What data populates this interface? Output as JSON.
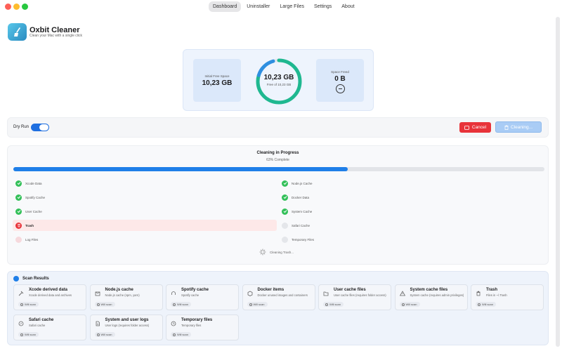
{
  "nav": {
    "tabs": [
      {
        "label": "Dashboard",
        "active": true
      },
      {
        "label": "Uninstaller",
        "active": false
      },
      {
        "label": "Large Files",
        "active": false
      },
      {
        "label": "Settings",
        "active": false
      },
      {
        "label": "About",
        "active": false
      }
    ]
  },
  "app": {
    "title": "Oxbit Cleaner",
    "subtitle": "Clean your Mac with a single click"
  },
  "space": {
    "initial_label": "Initial Free Space",
    "initial_value": "10,23 GB",
    "ring_value": "10,23 GB",
    "ring_sub": "Free of 10,23 GB",
    "freed_label": "Space Freed",
    "freed_value": "0 B"
  },
  "controls": {
    "dry_run_label": "Dry Run",
    "dry_run_on": true,
    "cancel_label": "Cancel",
    "cleaning_label": "Cleaning..."
  },
  "progress": {
    "title": "Cleaning in Progress",
    "percent_label": "63% Complete",
    "percent": 63,
    "status": "Cleaning Trash...",
    "tasks_left": [
      {
        "label": "Xcode Data",
        "state": "done"
      },
      {
        "label": "Spotify Cache",
        "state": "done"
      },
      {
        "label": "User Cache",
        "state": "done"
      },
      {
        "label": "Trash",
        "state": "active"
      },
      {
        "label": "Log Files",
        "state": "pending-red"
      }
    ],
    "tasks_right": [
      {
        "label": "Node.js Cache",
        "state": "done"
      },
      {
        "label": "Docker Data",
        "state": "done"
      },
      {
        "label": "System Cache",
        "state": "done"
      },
      {
        "label": "Safari Cache",
        "state": "pending"
      },
      {
        "label": "Temporary Files",
        "state": "pending"
      }
    ]
  },
  "results": {
    "title": "Scan Results",
    "badge_label": "Will scan",
    "items": [
      {
        "title": "Xcode derived data",
        "desc": "Xcode derived data and archives",
        "icon": "hammer-icon"
      },
      {
        "title": "Node.js cache",
        "desc": "Node.js cache (npm, yarn)",
        "icon": "package-icon"
      },
      {
        "title": "Spotify cache",
        "desc": "Spotify cache",
        "icon": "headphones-icon"
      },
      {
        "title": "Docker items",
        "desc": "Docker unused images and containers",
        "icon": "cube-icon"
      },
      {
        "title": "User cache files",
        "desc": "User cache files (requires folder access)",
        "icon": "folder-icon"
      },
      {
        "title": "System cache files",
        "desc": "System cache (requires admin privileges)",
        "icon": "warning-icon"
      },
      {
        "title": "Trash",
        "desc": "Files in ~/.Trash",
        "icon": "trash-icon"
      },
      {
        "title": "Safari cache",
        "desc": "Safari cache",
        "icon": "compass-icon"
      },
      {
        "title": "System and user logs",
        "desc": "User logs (requires folder access)",
        "icon": "document-icon"
      },
      {
        "title": "Temporary files",
        "desc": "Temporary files",
        "icon": "clock-icon"
      }
    ]
  }
}
